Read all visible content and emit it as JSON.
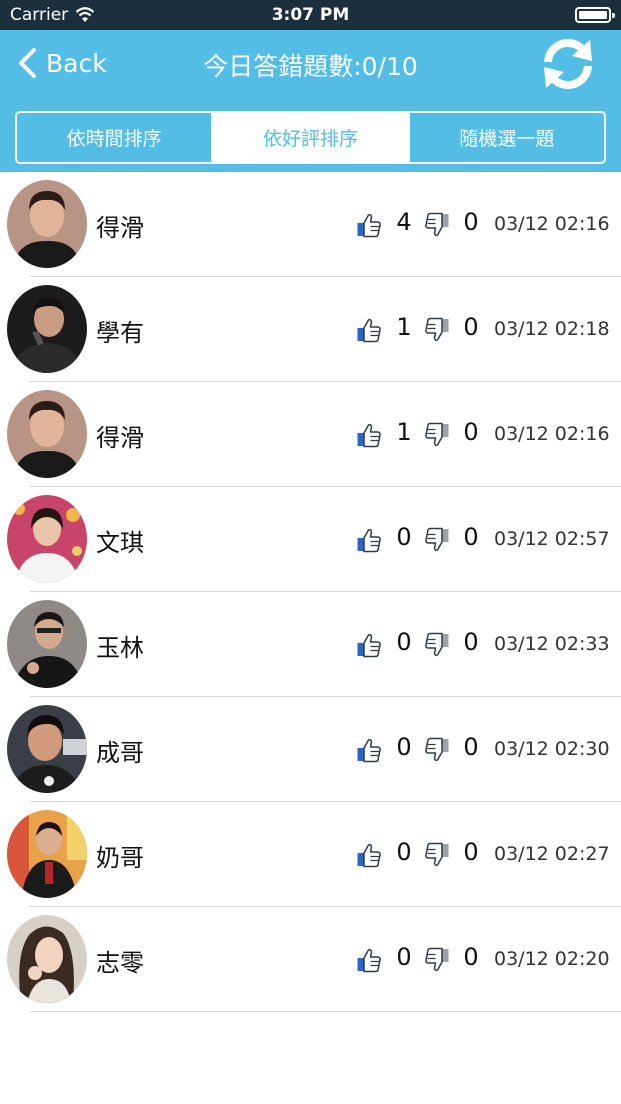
{
  "status_bar": {
    "carrier": "Carrier",
    "time": "3:07 PM"
  },
  "nav": {
    "back_label": "Back",
    "title": "今日答錯題數:0/10",
    "refresh_icon": "refresh-icon"
  },
  "segments": [
    {
      "label": "依時間排序",
      "selected": false
    },
    {
      "label": "依好評排序",
      "selected": true
    },
    {
      "label": "隨機選一題",
      "selected": false
    }
  ],
  "colors": {
    "header": "#53bde6",
    "status_bar": "#1c2f3f",
    "thumb_blue": "#2a66c9"
  },
  "rows": [
    {
      "name": "得滑",
      "likes": "4",
      "dislikes": "0",
      "time": "03/12 02:16"
    },
    {
      "name": "學有",
      "likes": "1",
      "dislikes": "0",
      "time": "03/12 02:18"
    },
    {
      "name": "得滑",
      "likes": "1",
      "dislikes": "0",
      "time": "03/12 02:16"
    },
    {
      "name": "文琪",
      "likes": "0",
      "dislikes": "0",
      "time": "03/12 02:57"
    },
    {
      "name": "玉林",
      "likes": "0",
      "dislikes": "0",
      "time": "03/12 02:33"
    },
    {
      "name": "成哥",
      "likes": "0",
      "dislikes": "0",
      "time": "03/12 02:30"
    },
    {
      "name": "奶哥",
      "likes": "0",
      "dislikes": "0",
      "time": "03/12 02:27"
    },
    {
      "name": "志零",
      "likes": "0",
      "dislikes": "0",
      "time": "03/12 02:20"
    }
  ]
}
